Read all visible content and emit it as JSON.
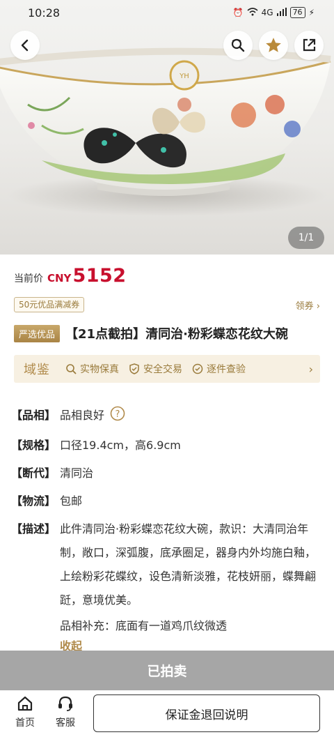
{
  "status_bar": {
    "time": "10:28",
    "network": "4G",
    "battery": "76"
  },
  "gallery": {
    "indicator": "1/1",
    "sticker_text": "YH"
  },
  "price": {
    "label": "当前价",
    "currency": "CNY",
    "value": "5152"
  },
  "coupon": {
    "tag": "50元优品满减券",
    "link": "领券 ›"
  },
  "product": {
    "badge": "严选优品",
    "title": "【21点截拍】清同治·粉彩蝶恋花纹大碗"
  },
  "assurance": {
    "logo": "域鉴",
    "items": [
      {
        "label": "实物保真",
        "icon": "search-icon"
      },
      {
        "label": "安全交易",
        "icon": "shield-check-icon"
      },
      {
        "label": "逐件查验",
        "icon": "check-circle-icon"
      }
    ],
    "arrow": "›"
  },
  "attributes": {
    "condition": {
      "key": "【品相】",
      "value": "品相良好"
    },
    "size": {
      "key": "【规格】",
      "value": "口径19.4cm，高6.9cm"
    },
    "period": {
      "key": "【断代】",
      "value": "清同治"
    },
    "shipping": {
      "key": "【物流】",
      "value": "包邮"
    },
    "description": {
      "key": "【描述】",
      "value": "此件清同治·粉彩蝶恋花纹大碗，款识：大清同治年制，敞口，深弧腹，底承圈足，器身内外均施白釉，上绘粉彩花蝶纹，设色清新淡雅，花枝妍丽，蝶舞翩跹，意境优美。"
    },
    "supplement": "品相补充：底面有一道鸡爪纹微透",
    "collapse": "收起"
  },
  "sold_label": "已拍卖",
  "bottom_nav": {
    "home": "首页",
    "service": "客服",
    "deposit_button": "保证金退回说明"
  },
  "colors": {
    "price_red": "#c8102e",
    "gold": "#b08a4a",
    "sold_gray": "#a6a6a6"
  }
}
